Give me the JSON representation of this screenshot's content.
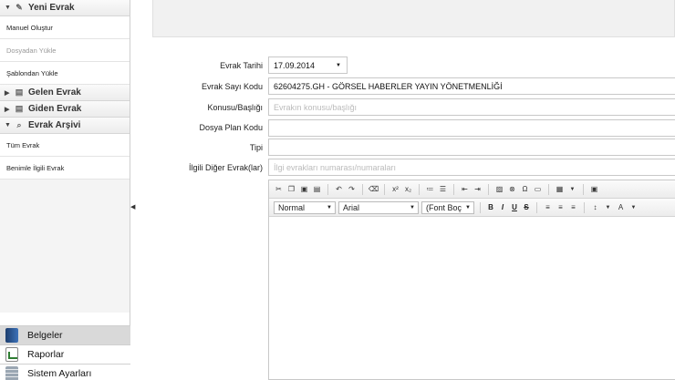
{
  "sidebar": {
    "new_doc": {
      "label": "Yeni Evrak"
    },
    "new_doc_items": [
      "Manuel Oluştur",
      "Dosyadan Yükle",
      "Şablondan Yükle"
    ],
    "incoming": {
      "label": "Gelen Evrak"
    },
    "outgoing": {
      "label": "Giden Evrak"
    },
    "archive": {
      "label": "Evrak Arşivi"
    },
    "archive_items": [
      "Tüm Evrak",
      "Benimle İlgili Evrak"
    ]
  },
  "bottom_nav": [
    "Belgeler",
    "Raporlar",
    "Sistem Ayarları"
  ],
  "form": {
    "date_label": "Evrak Tarihi",
    "date_value": "17.09.2014",
    "number_label": "Evrak Sayı Kodu",
    "number_value": "62604275.GH - GÖRSEL HABERLER YAYIN YÖNETMENLİĞİ",
    "subject_label": "Konusu/Başlığı",
    "subject_placeholder": "Evrakın konusu/başlığı",
    "plan_label": "Dosya Plan Kodu",
    "type_label": "Tipi",
    "related_label": "İlgili Diğer Evrak(lar)",
    "related_placeholder": "İlgi evrakları numarası/numaraları"
  },
  "editor": {
    "format_select": "Normal",
    "font_select": "Arial",
    "size_select": "(Font Boç",
    "bold": "B",
    "italic": "I",
    "underline": "U",
    "strike": "S"
  },
  "colors": {
    "active_nav": "#d9d9d9",
    "topbar": "#f1f1f1",
    "docs_icon": "#2b5796"
  }
}
